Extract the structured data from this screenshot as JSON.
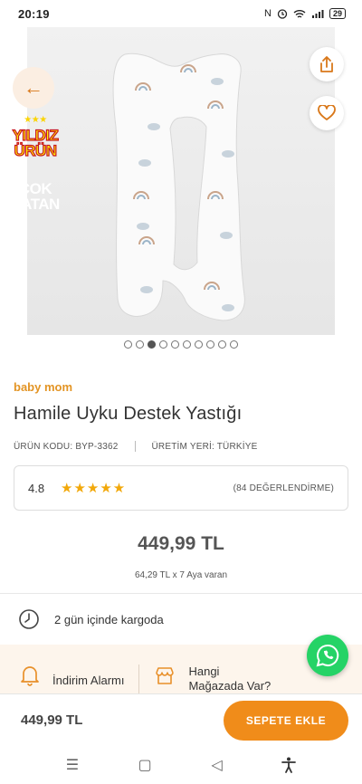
{
  "status": {
    "time": "20:19",
    "battery": "29"
  },
  "badges": {
    "star_line1": "YILDIZ",
    "star_line2": "ÜRÜN",
    "cok_line1": "ÇOK",
    "cok_line2": "SATAN"
  },
  "gallery": {
    "total_images": 10,
    "active_index": 2
  },
  "product": {
    "brand": "baby mom",
    "title": "Hamile Uyku Destek Yastığı",
    "code": "ÜRÜN KODU: BYP-3362",
    "origin": "ÜRETİM YERİ: TÜRKİYE",
    "rating": "4.8",
    "stars": 5,
    "reviews": "(84 DEĞERLENDİRME)",
    "price": "449,99 TL",
    "installment": "64,29 TL x 7 Aya varan"
  },
  "shipping": {
    "text": "2 gün içinde kargoda"
  },
  "alerts": {
    "discount": "İndirim Alarmı",
    "store_line1": "Hangi",
    "store_line2": "Mağazada Var?"
  },
  "bottom": {
    "price": "449,99 TL",
    "add_to_cart": "SEPETE EKLE"
  },
  "colors": {
    "accent": "#f08c1a",
    "brand": "#e39424",
    "whatsapp": "#25d366",
    "star": "#f2a80a"
  },
  "icons": [
    "back-arrow-icon",
    "share-icon",
    "heart-icon",
    "clock-icon",
    "bell-icon",
    "store-icon",
    "whatsapp-icon",
    "menu-icon",
    "home-icon",
    "back-icon",
    "accessibility-icon"
  ]
}
